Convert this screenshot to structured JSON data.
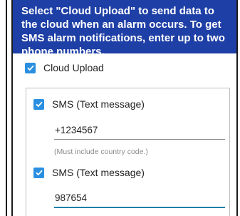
{
  "banner": {
    "text": "Select \"Cloud Upload\" to send data to the cloud when an alarm occurs. To get SMS alarm notifications, enter up to two phone numbers."
  },
  "cloud_upload": {
    "label": "Cloud Upload",
    "checked": true
  },
  "sms": [
    {
      "label": "SMS (Text message)",
      "checked": true,
      "value": "+1234567",
      "helper": "(Must include country code.)"
    },
    {
      "label": "SMS (Text message)",
      "checked": true,
      "value": "987654"
    }
  ],
  "colors": {
    "banner_bg": "#1e3fa6",
    "checkbox": "#2a8fe0",
    "focus_underline": "#1d7fa6"
  },
  "icons": {
    "checkbox_check": "check-icon"
  }
}
